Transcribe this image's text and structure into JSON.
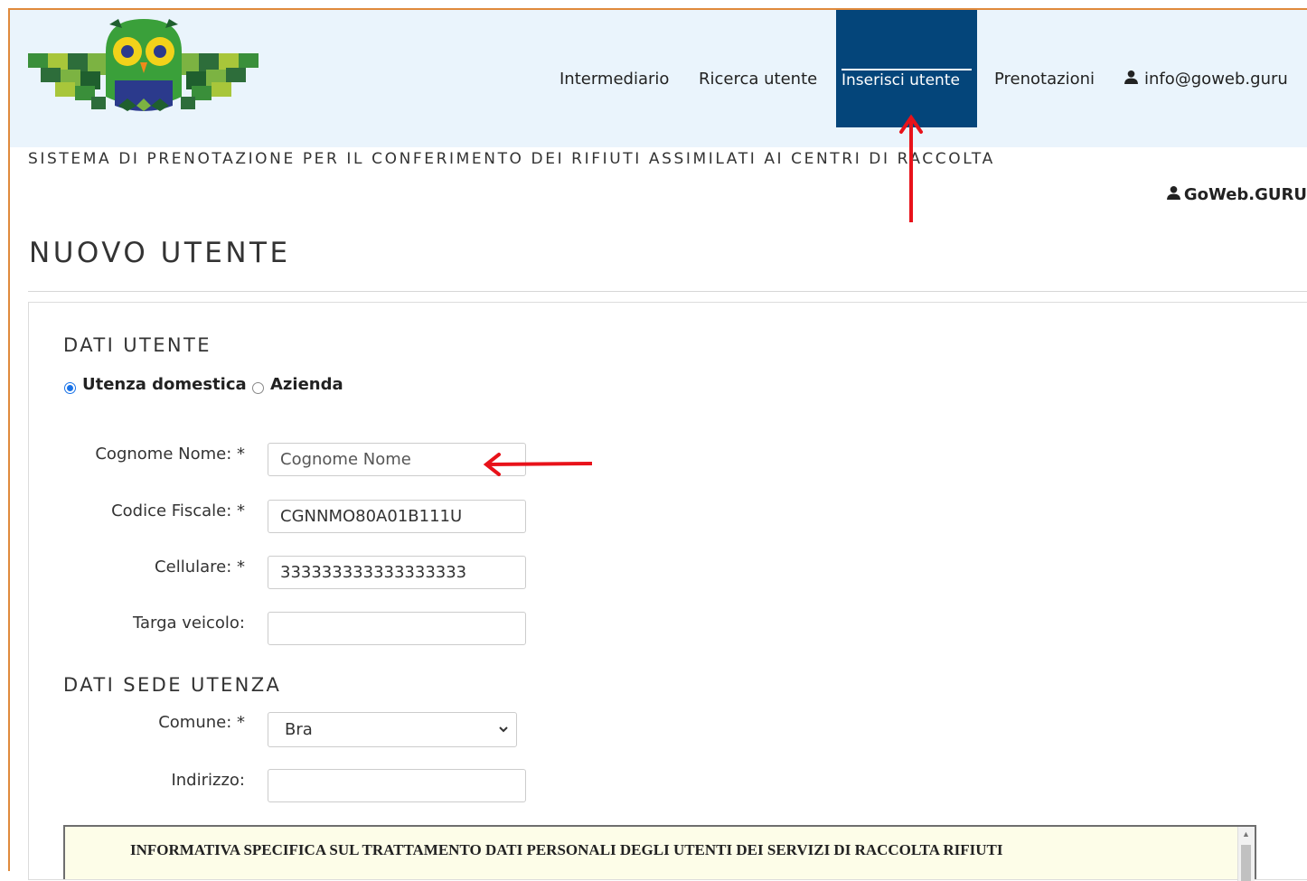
{
  "nav": {
    "items": [
      {
        "label": "Intermediario"
      },
      {
        "label": "Ricerca utente"
      },
      {
        "label": "Inserisci utente"
      },
      {
        "label": "Prenotazioni"
      }
    ],
    "user_email": "info@goweb.guru"
  },
  "header": {
    "subtitle": "SISTEMA DI PRENOTAZIONE PER IL CONFERIMENTO DEI RIFIUTI ASSIMILATI AI CENTRI DI RACCOLTA",
    "logged_user": "GoWeb.GURU"
  },
  "page": {
    "title": "NUOVO UTENTE"
  },
  "dati_utente": {
    "heading": "DATI UTENTE",
    "radio_domestica": "Utenza domestica",
    "radio_azienda": "Azienda",
    "selected": "Utenza domestica",
    "fields": [
      {
        "label": "Cognome Nome: *",
        "value": "",
        "placeholder": "Cognome Nome"
      },
      {
        "label": "Codice Fiscale: *",
        "value": "CGNNMO80A01B111U",
        "placeholder": ""
      },
      {
        "label": "Cellulare: *",
        "value": "333333333333333333",
        "placeholder": ""
      },
      {
        "label": "Targa veicolo:",
        "value": "",
        "placeholder": ""
      }
    ]
  },
  "dati_sede": {
    "heading": "DATI SEDE UTENZA",
    "comune_label": "Comune: *",
    "comune_value": "Bra",
    "indirizzo_label": "Indirizzo:",
    "indirizzo_value": ""
  },
  "informativa": {
    "title": "INFORMATIVA SPECIFICA SUL TRATTAMENTO DATI PERSONALI DEGLI UTENTI DEI SERVIZI DI RACCOLTA RIFIUTI"
  },
  "colors": {
    "nav_active_bg": "#04457a",
    "header_bg": "#eaf4fc",
    "annotation_arrow": "#e8121a"
  }
}
